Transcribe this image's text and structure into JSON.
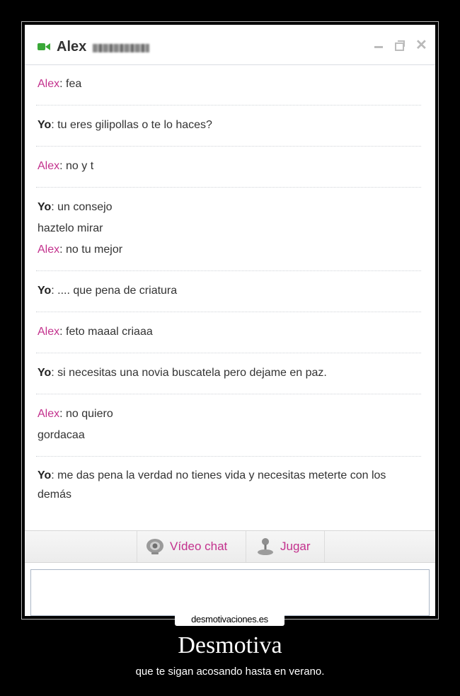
{
  "chat_window": {
    "contact_name": "Alex",
    "messages": [
      {
        "lines": [
          {
            "sender": "Alex",
            "text": "fea"
          }
        ]
      },
      {
        "lines": [
          {
            "sender": "Yo",
            "text": "tu eres gilipollas o te lo haces?"
          }
        ]
      },
      {
        "lines": [
          {
            "sender": "Alex",
            "text": "no y t"
          }
        ]
      },
      {
        "lines": [
          {
            "sender": "Yo",
            "text": "un consejo"
          },
          {
            "sender": "",
            "text": "haztelo mirar"
          },
          {
            "sender": "Alex",
            "text": "no tu mejor"
          }
        ]
      },
      {
        "lines": [
          {
            "sender": "Yo",
            "text": ".... que pena de criatura"
          }
        ]
      },
      {
        "lines": [
          {
            "sender": "Alex",
            "text": "feto maaal criaaa"
          }
        ]
      },
      {
        "lines": [
          {
            "sender": "Yo",
            "text": "si necesitas una novia buscatela pero dejame en paz."
          }
        ]
      },
      {
        "lines": [
          {
            "sender": "Alex",
            "text": "no quiero"
          },
          {
            "sender": "",
            "text": "gordacaa"
          }
        ]
      },
      {
        "lines": [
          {
            "sender": "Yo",
            "text": "me das pena la verdad no tienes vida y necesitas meterte con los demás"
          }
        ]
      }
    ],
    "buttons": {
      "video_chat": "Vídeo chat",
      "play": "Jugar"
    },
    "input": {
      "placeholder": ""
    }
  },
  "watermark": "desmotivaciones.es",
  "poster": {
    "title": "Desmotiva",
    "subtitle": "que te sigan acosando hasta en verano."
  },
  "colors": {
    "accent": "#c3318d",
    "background": "#000000"
  }
}
